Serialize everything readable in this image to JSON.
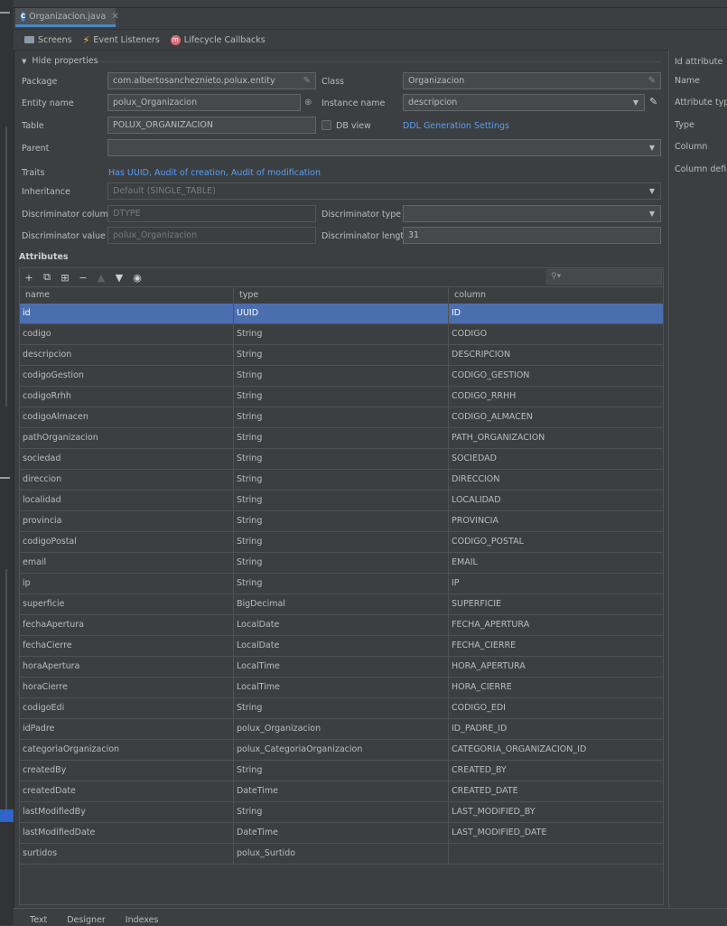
{
  "editor_tab": {
    "title": "Organizacion.java"
  },
  "toolbar": {
    "screens": "Screens",
    "event_listeners": "Event Listeners",
    "lifecycle_callbacks": "Lifecycle Callbacks"
  },
  "properties": {
    "hide_label": "Hide properties",
    "package_label": "Package",
    "package_value": "com.albertosancheznieto.polux.entity",
    "class_label": "Class",
    "class_value": "Organizacion",
    "entity_name_label": "Entity name",
    "entity_name_value": "polux_Organizacion",
    "instance_name_label": "Instance name",
    "instance_name_value": "descripcion",
    "table_label": "Table",
    "table_value": "POLUX_ORGANIZACION",
    "db_view_label": "DB view",
    "ddl_link": "DDL Generation Settings",
    "parent_label": "Parent",
    "parent_value": "",
    "traits_label": "Traits",
    "traits_value": "Has UUID, Audit of creation, Audit of modification",
    "inheritance_label": "Inheritance",
    "inheritance_value": "Default (SINGLE_TABLE)",
    "disc_column_label": "Discriminator column",
    "disc_column_value": "DTYPE",
    "disc_type_label": "Discriminator type",
    "disc_type_value": "",
    "disc_value_label": "Discriminator value",
    "disc_value_value": "polux_Organizacion",
    "disc_length_label": "Discriminator length",
    "disc_length_value": "31"
  },
  "attributes": {
    "title": "Attributes",
    "columns": [
      "name",
      "type",
      "column"
    ],
    "rows": [
      [
        "id",
        "UUID",
        "ID"
      ],
      [
        "codigo",
        "String",
        "CODIGO"
      ],
      [
        "descripcion",
        "String",
        "DESCRIPCION"
      ],
      [
        "codigoGestion",
        "String",
        "CODIGO_GESTION"
      ],
      [
        "codigoRrhh",
        "String",
        "CODIGO_RRHH"
      ],
      [
        "codigoAlmacen",
        "String",
        "CODIGO_ALMACEN"
      ],
      [
        "pathOrganizacion",
        "String",
        "PATH_ORGANIZACION"
      ],
      [
        "sociedad",
        "String",
        "SOCIEDAD"
      ],
      [
        "direccion",
        "String",
        "DIRECCION"
      ],
      [
        "localidad",
        "String",
        "LOCALIDAD"
      ],
      [
        "provincia",
        "String",
        "PROVINCIA"
      ],
      [
        "codigoPostal",
        "String",
        "CODIGO_POSTAL"
      ],
      [
        "email",
        "String",
        "EMAIL"
      ],
      [
        "ip",
        "String",
        "IP"
      ],
      [
        "superficie",
        "BigDecimal",
        "SUPERFICIE"
      ],
      [
        "fechaApertura",
        "LocalDate",
        "FECHA_APERTURA"
      ],
      [
        "fechaCierre",
        "LocalDate",
        "FECHA_CIERRE"
      ],
      [
        "horaApertura",
        "LocalTime",
        "HORA_APERTURA"
      ],
      [
        "horaCierre",
        "LocalTime",
        "HORA_CIERRE"
      ],
      [
        "codigoEdi",
        "String",
        "CODIGO_EDI"
      ],
      [
        "idPadre",
        "polux_Organizacion",
        "ID_PADRE_ID"
      ],
      [
        "categoriaOrganizacion",
        "polux_CategoriaOrganizacion",
        "CATEGORIA_ORGANIZACION_ID"
      ],
      [
        "createdBy",
        "String",
        "CREATED_BY"
      ],
      [
        "createdDate",
        "DateTime",
        "CREATED_DATE"
      ],
      [
        "lastModifiedBy",
        "String",
        "LAST_MODIFIED_BY"
      ],
      [
        "lastModifiedDate",
        "DateTime",
        "LAST_MODIFIED_DATE"
      ],
      [
        "surtidos",
        "polux_Surtido",
        ""
      ]
    ],
    "selected_row": 0
  },
  "right_panel": {
    "title": "Id attribute",
    "name_label": "Name",
    "attribute_type_label": "Attribute type",
    "type_label": "Type",
    "column_label": "Column",
    "column_definition_label": "Column defini"
  },
  "bottom_tabs": [
    "Text",
    "Designer",
    "Indexes"
  ]
}
